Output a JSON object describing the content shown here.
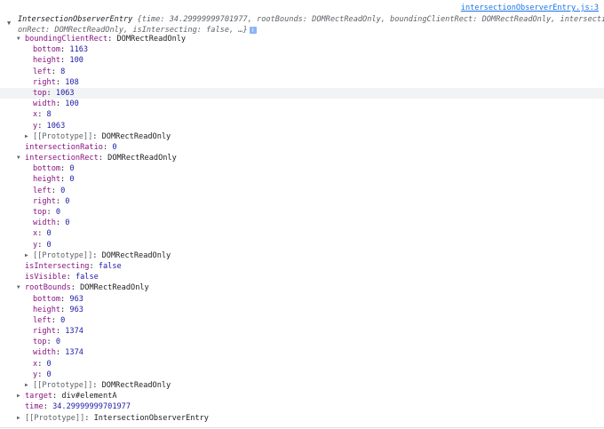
{
  "source_link": "intersectionObserverEntry.js:3",
  "summary": {
    "class_name": "IntersectionObserverEntry",
    "line1_rest": " {time: 34.29999999701977, rootBounds: DOMRectReadOnly, boundingClientRect: DOMRectReadOnly, intersecti",
    "line2": "onRect: DOMRectReadOnly, isIntersecting: false, …}",
    "info": "i"
  },
  "tree": [
    {
      "indent": 1,
      "toggle": "expanded",
      "key": "boundingClientRect",
      "value": "DOMRectReadOnly",
      "vtype": "obj"
    },
    {
      "indent": 2,
      "key": "bottom",
      "value": "1163",
      "vtype": "num"
    },
    {
      "indent": 2,
      "key": "height",
      "value": "100",
      "vtype": "num"
    },
    {
      "indent": 2,
      "key": "left",
      "value": "8",
      "vtype": "num"
    },
    {
      "indent": 2,
      "key": "right",
      "value": "108",
      "vtype": "num"
    },
    {
      "indent": 2,
      "key": "top",
      "value": "1063",
      "vtype": "num",
      "highlight": true
    },
    {
      "indent": 2,
      "key": "width",
      "value": "100",
      "vtype": "num"
    },
    {
      "indent": 2,
      "key": "x",
      "value": "8",
      "vtype": "num"
    },
    {
      "indent": 2,
      "key": "y",
      "value": "1063",
      "vtype": "num"
    },
    {
      "indent": 2,
      "toggle": "collapsed",
      "key": "[[Prototype]]",
      "value": "DOMRectReadOnly",
      "vtype": "obj",
      "proto": true
    },
    {
      "indent": 1,
      "key": "intersectionRatio",
      "value": "0",
      "vtype": "num"
    },
    {
      "indent": 1,
      "toggle": "expanded",
      "key": "intersectionRect",
      "value": "DOMRectReadOnly",
      "vtype": "obj"
    },
    {
      "indent": 2,
      "key": "bottom",
      "value": "0",
      "vtype": "num"
    },
    {
      "indent": 2,
      "key": "height",
      "value": "0",
      "vtype": "num"
    },
    {
      "indent": 2,
      "key": "left",
      "value": "0",
      "vtype": "num"
    },
    {
      "indent": 2,
      "key": "right",
      "value": "0",
      "vtype": "num"
    },
    {
      "indent": 2,
      "key": "top",
      "value": "0",
      "vtype": "num"
    },
    {
      "indent": 2,
      "key": "width",
      "value": "0",
      "vtype": "num"
    },
    {
      "indent": 2,
      "key": "x",
      "value": "0",
      "vtype": "num"
    },
    {
      "indent": 2,
      "key": "y",
      "value": "0",
      "vtype": "num"
    },
    {
      "indent": 2,
      "toggle": "collapsed",
      "key": "[[Prototype]]",
      "value": "DOMRectReadOnly",
      "vtype": "obj",
      "proto": true
    },
    {
      "indent": 1,
      "key": "isIntersecting",
      "value": "false",
      "vtype": "kw"
    },
    {
      "indent": 1,
      "key": "isVisible",
      "value": "false",
      "vtype": "kw"
    },
    {
      "indent": 1,
      "toggle": "expanded",
      "key": "rootBounds",
      "value": "DOMRectReadOnly",
      "vtype": "obj"
    },
    {
      "indent": 2,
      "key": "bottom",
      "value": "963",
      "vtype": "num"
    },
    {
      "indent": 2,
      "key": "height",
      "value": "963",
      "vtype": "num"
    },
    {
      "indent": 2,
      "key": "left",
      "value": "0",
      "vtype": "num"
    },
    {
      "indent": 2,
      "key": "right",
      "value": "1374",
      "vtype": "num"
    },
    {
      "indent": 2,
      "key": "top",
      "value": "0",
      "vtype": "num"
    },
    {
      "indent": 2,
      "key": "width",
      "value": "1374",
      "vtype": "num"
    },
    {
      "indent": 2,
      "key": "x",
      "value": "0",
      "vtype": "num"
    },
    {
      "indent": 2,
      "key": "y",
      "value": "0",
      "vtype": "num"
    },
    {
      "indent": 2,
      "toggle": "collapsed",
      "key": "[[Prototype]]",
      "value": "DOMRectReadOnly",
      "vtype": "obj",
      "proto": true
    },
    {
      "indent": 1,
      "toggle": "collapsed",
      "key": "target",
      "value": "div#elementA",
      "vtype": "obj"
    },
    {
      "indent": 1,
      "key": "time",
      "value": "34.29999999701977",
      "vtype": "num"
    },
    {
      "indent": 1,
      "toggle": "collapsed",
      "key": "[[Prototype]]",
      "value": "IntersectionObserverEntry",
      "vtype": "obj",
      "proto": true
    }
  ]
}
